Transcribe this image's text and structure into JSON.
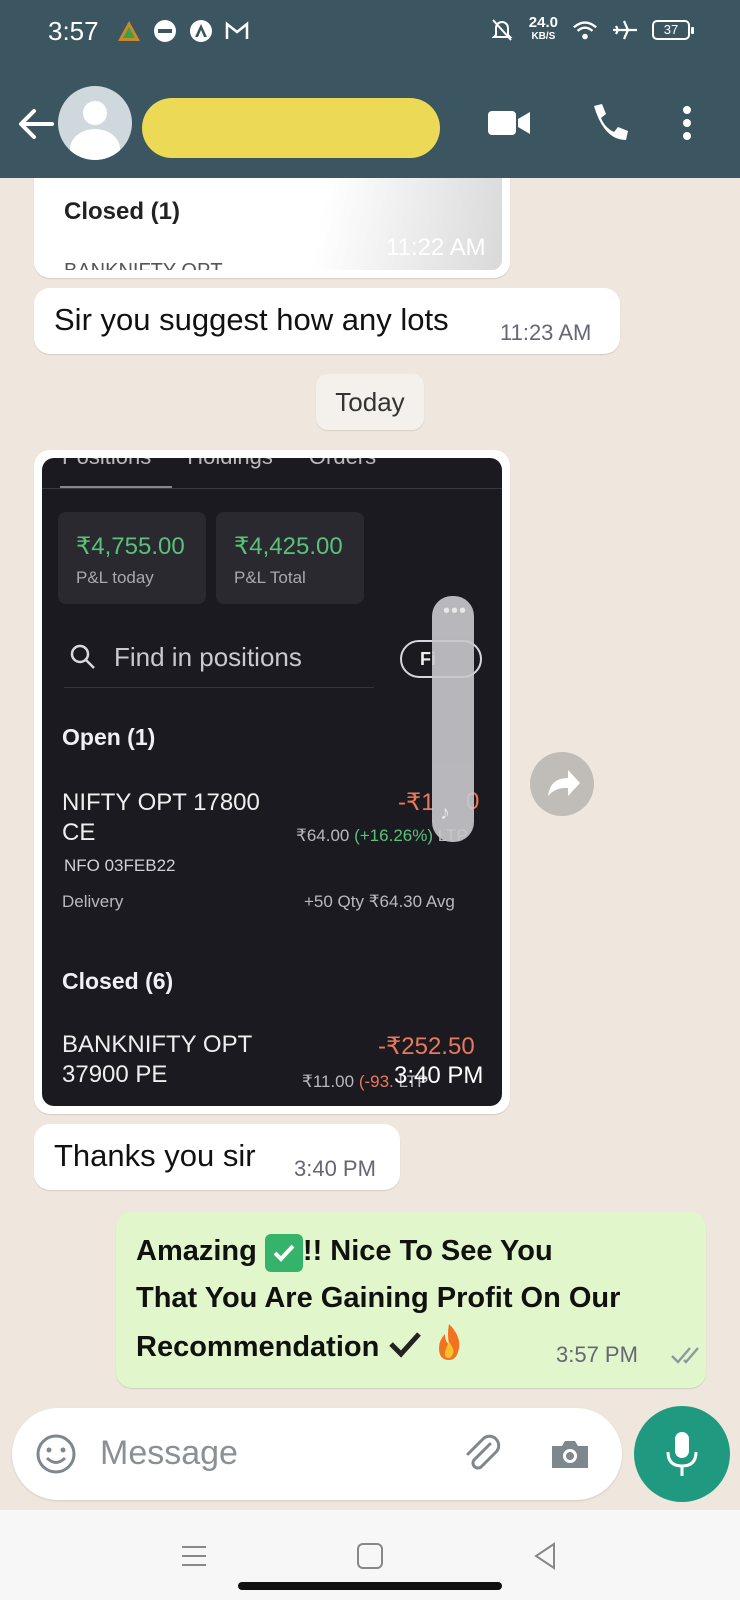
{
  "status_bar": {
    "time": "3:57",
    "net_speed": "24.0",
    "net_unit": "KB/S",
    "battery": "37"
  },
  "header": {
    "contact_name_redacted": true,
    "icons": [
      "back-arrow-icon",
      "avatar",
      "video-call-icon",
      "phone-icon",
      "more-vert-icon"
    ]
  },
  "messages": {
    "m0": {
      "label": "Closed (1)",
      "time": "11:22 AM",
      "cut_text": "BANKNIFTY OPT"
    },
    "m1": {
      "text": "Sir you suggest how any lots",
      "time": "11:23 AM"
    },
    "date_chip": "Today",
    "m3": {
      "text": "Thanks you sir",
      "time": "3:40 PM"
    },
    "m4": {
      "line1a": "Amazing",
      "line1b": "!! Nice   To See You",
      "line2": "That You Are Gaining Profit On  Our",
      "line3": "Recommendation",
      "time": "3:57 PM"
    }
  },
  "screenshot": {
    "tabs": [
      "Positions",
      "Holdings",
      "Orders"
    ],
    "pl_today_value": "₹4,755.00",
    "pl_today_label": "P&L today",
    "pl_total_value": "₹4,425.00",
    "pl_total_label": "P&L Total",
    "search_placeholder": "Find in positions",
    "filter_label": "Fi",
    "open_header": "Open (1)",
    "open_name1": "NIFTY OPT 17800",
    "open_name2": "CE",
    "open_pnl": "-₹1",
    "open_pnl_end": "0",
    "open_ltp_a": "₹64.00 ",
    "open_ltp_b": "(+16.26%)",
    "open_ltp_c": " LTP",
    "open_expiry": "NFO 03FEB22",
    "open_type": "Delivery",
    "open_qty": "+50 Qty  ₹64.30 Avg",
    "closed_header": "Closed (6)",
    "closed_name1": "BANKNIFTY OPT",
    "closed_name2": "37900 PE",
    "closed_pnl": "-₹252.50",
    "closed_ltp_a": "₹11.00 ",
    "closed_ltp_b": "(-93.",
    "closed_ltp_c": " LTP",
    "image_time": "3:40 PM"
  },
  "composer": {
    "placeholder": "Message"
  },
  "colors": {
    "header_bg": "#3b5660",
    "chat_bg": "#efe7dd",
    "outgoing_bubble": "#e1f7cb",
    "mic_button": "#1f9a80",
    "profit_green": "#58c27a",
    "loss_red": "#e8795e"
  }
}
